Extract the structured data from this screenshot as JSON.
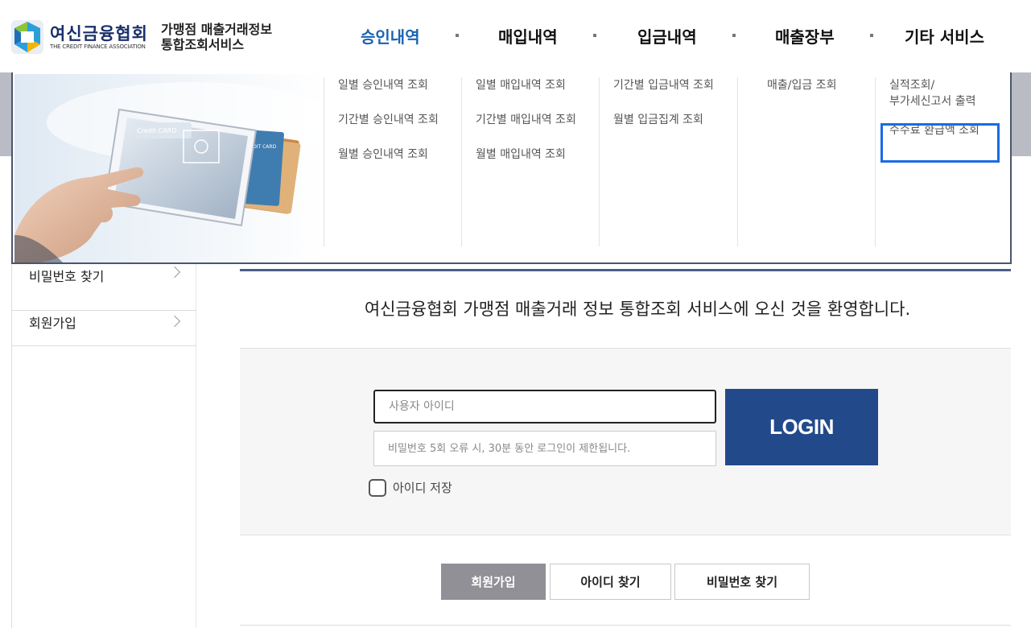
{
  "header": {
    "logo_ko": "여신금융협회",
    "logo_en": "THE CREDIT FINANCE ASSOCIATION",
    "service_title_line1": "가맹점 매출거래정보",
    "service_title_line2": "통합조회서비스"
  },
  "gnb": [
    {
      "label": "승인내역",
      "active": true
    },
    {
      "label": "매입내역",
      "active": false
    },
    {
      "label": "입금내역",
      "active": false
    },
    {
      "label": "매출장부",
      "active": false
    },
    {
      "label": "기타 서비스",
      "active": false
    }
  ],
  "mega_menu": {
    "approval": [
      "일별 승인내역 조회",
      "기간별 승인내역 조회",
      "월별 승인내역 조회"
    ],
    "purchase": [
      "일별 매입내역 조회",
      "기간별 매입내역 조회",
      "월별 매입내역 조회"
    ],
    "deposit": [
      "기간별 입금내역 조회",
      "월별 입금집계 조회"
    ],
    "ledger": [
      "매출/입금 조회"
    ],
    "etc": [
      "실적조회/",
      "부가세신고서 출력",
      "수수료 환급액 조회"
    ]
  },
  "tablet_image": {
    "card1": "Credit CARD",
    "card2": "CREDIT CARD"
  },
  "sidebar": {
    "items": [
      "비밀번호 찾기",
      "회원가입"
    ]
  },
  "main": {
    "welcome": "여신금융협회 가맹점 매출거래 정보 통합조회 서비스에 오신 것을 환영합니다.",
    "id_placeholder": "사용자 아이디",
    "pw_placeholder": "비밀번호 5회 오류 시, 30분 동안 로그인이 제한됩니다.",
    "login_label": "LOGIN",
    "save_id_label": "아이디 저장",
    "buttons": [
      "회원가입",
      "아이디 찾기",
      "비밀번호 찾기"
    ]
  },
  "colors": {
    "accent": "#1a63b3",
    "login": "#22498a",
    "highlight": "#1a6be5"
  }
}
